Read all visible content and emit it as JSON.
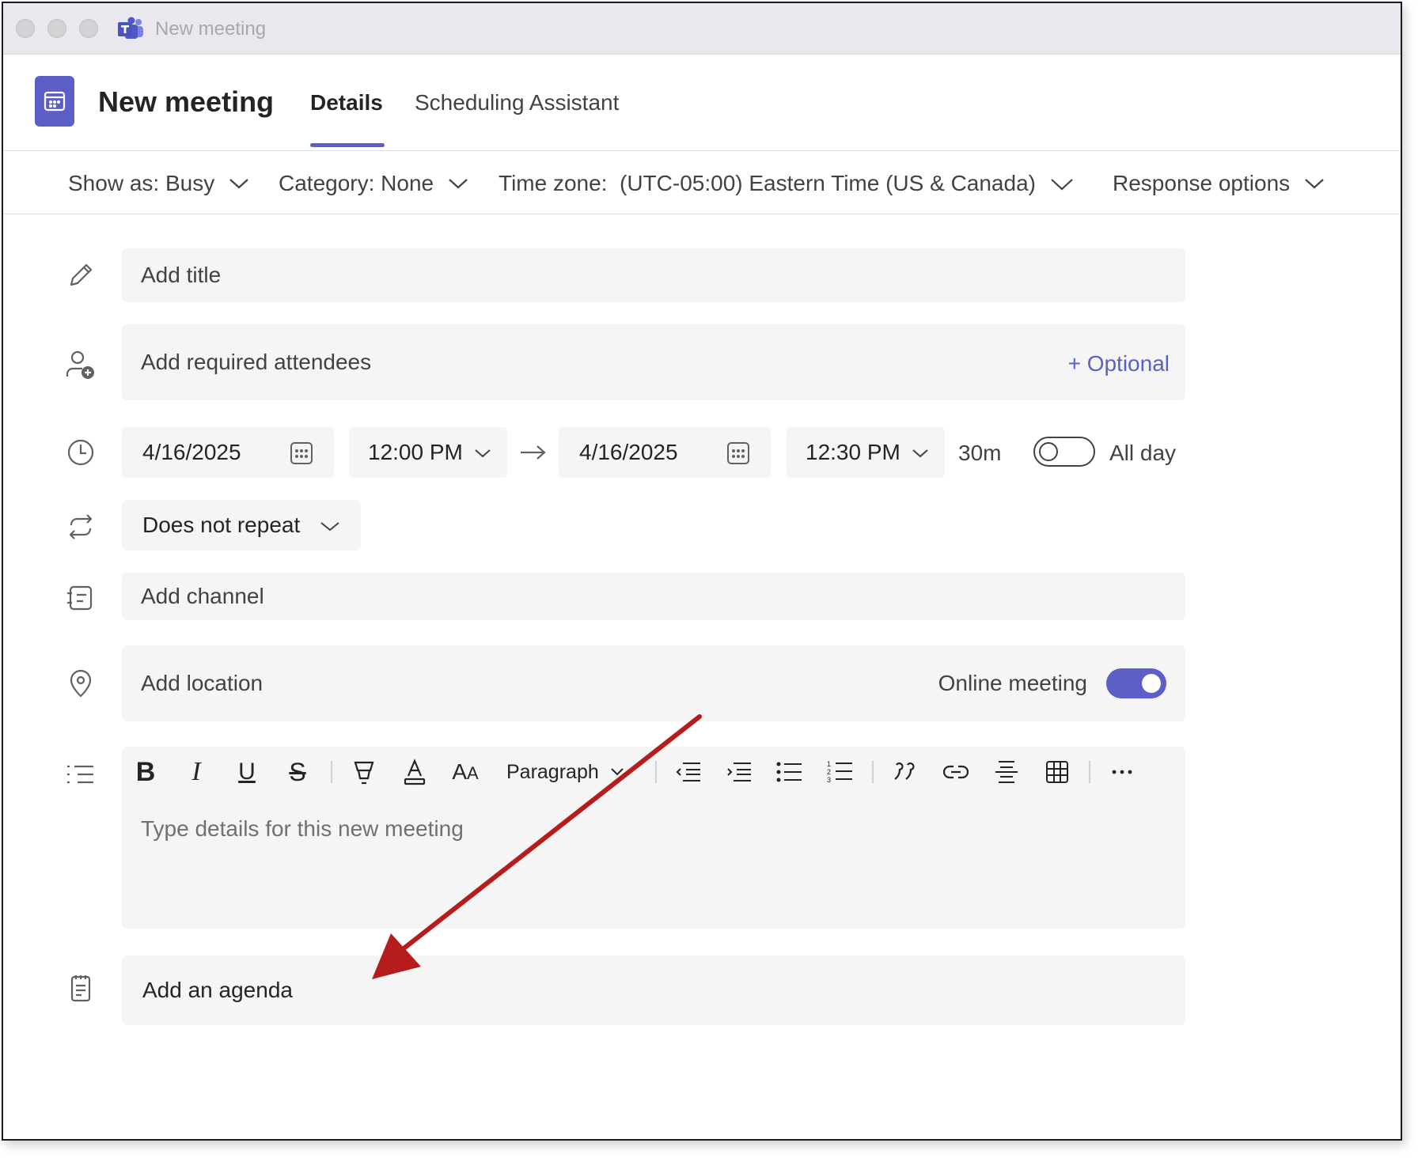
{
  "window": {
    "title": "New meeting"
  },
  "header": {
    "title": "New meeting",
    "tabs": [
      {
        "label": "Details",
        "active": true
      },
      {
        "label": "Scheduling Assistant",
        "active": false
      }
    ]
  },
  "options_bar": {
    "show_as": "Show as: Busy",
    "category": "Category: None",
    "time_zone": "Time zone:  (UTC-05:00) Eastern Time (US & Canada)",
    "response_options": "Response options"
  },
  "form": {
    "title_placeholder": "Add title",
    "attendees_placeholder": "Add required attendees",
    "optional_link": "+ Optional",
    "start_date": "4/16/2025",
    "start_time": "12:00 PM",
    "end_date": "4/16/2025",
    "end_time": "12:30 PM",
    "duration": "30m",
    "all_day_label": "All day",
    "all_day_on": false,
    "repeat": "Does not repeat",
    "channel_placeholder": "Add channel",
    "location_placeholder": "Add location",
    "online_meeting_label": "Online meeting",
    "online_meeting_on": true,
    "details_placeholder": "Type details for this new meeting",
    "paragraph_style": "Paragraph",
    "agenda_placeholder": "Add an agenda"
  },
  "colors": {
    "accent": "#5b5fc7",
    "field_background": "#f5f5f5",
    "annotation_arrow": "#b71c1c"
  },
  "icons": {
    "app": "teams-logo-icon",
    "tile": "calendar-icon",
    "rows": [
      "pencil-icon",
      "add-person-icon",
      "clock-icon",
      "repeat-icon",
      "channel-icon",
      "location-pin-icon",
      "details-list-icon",
      "agenda-icon"
    ]
  }
}
